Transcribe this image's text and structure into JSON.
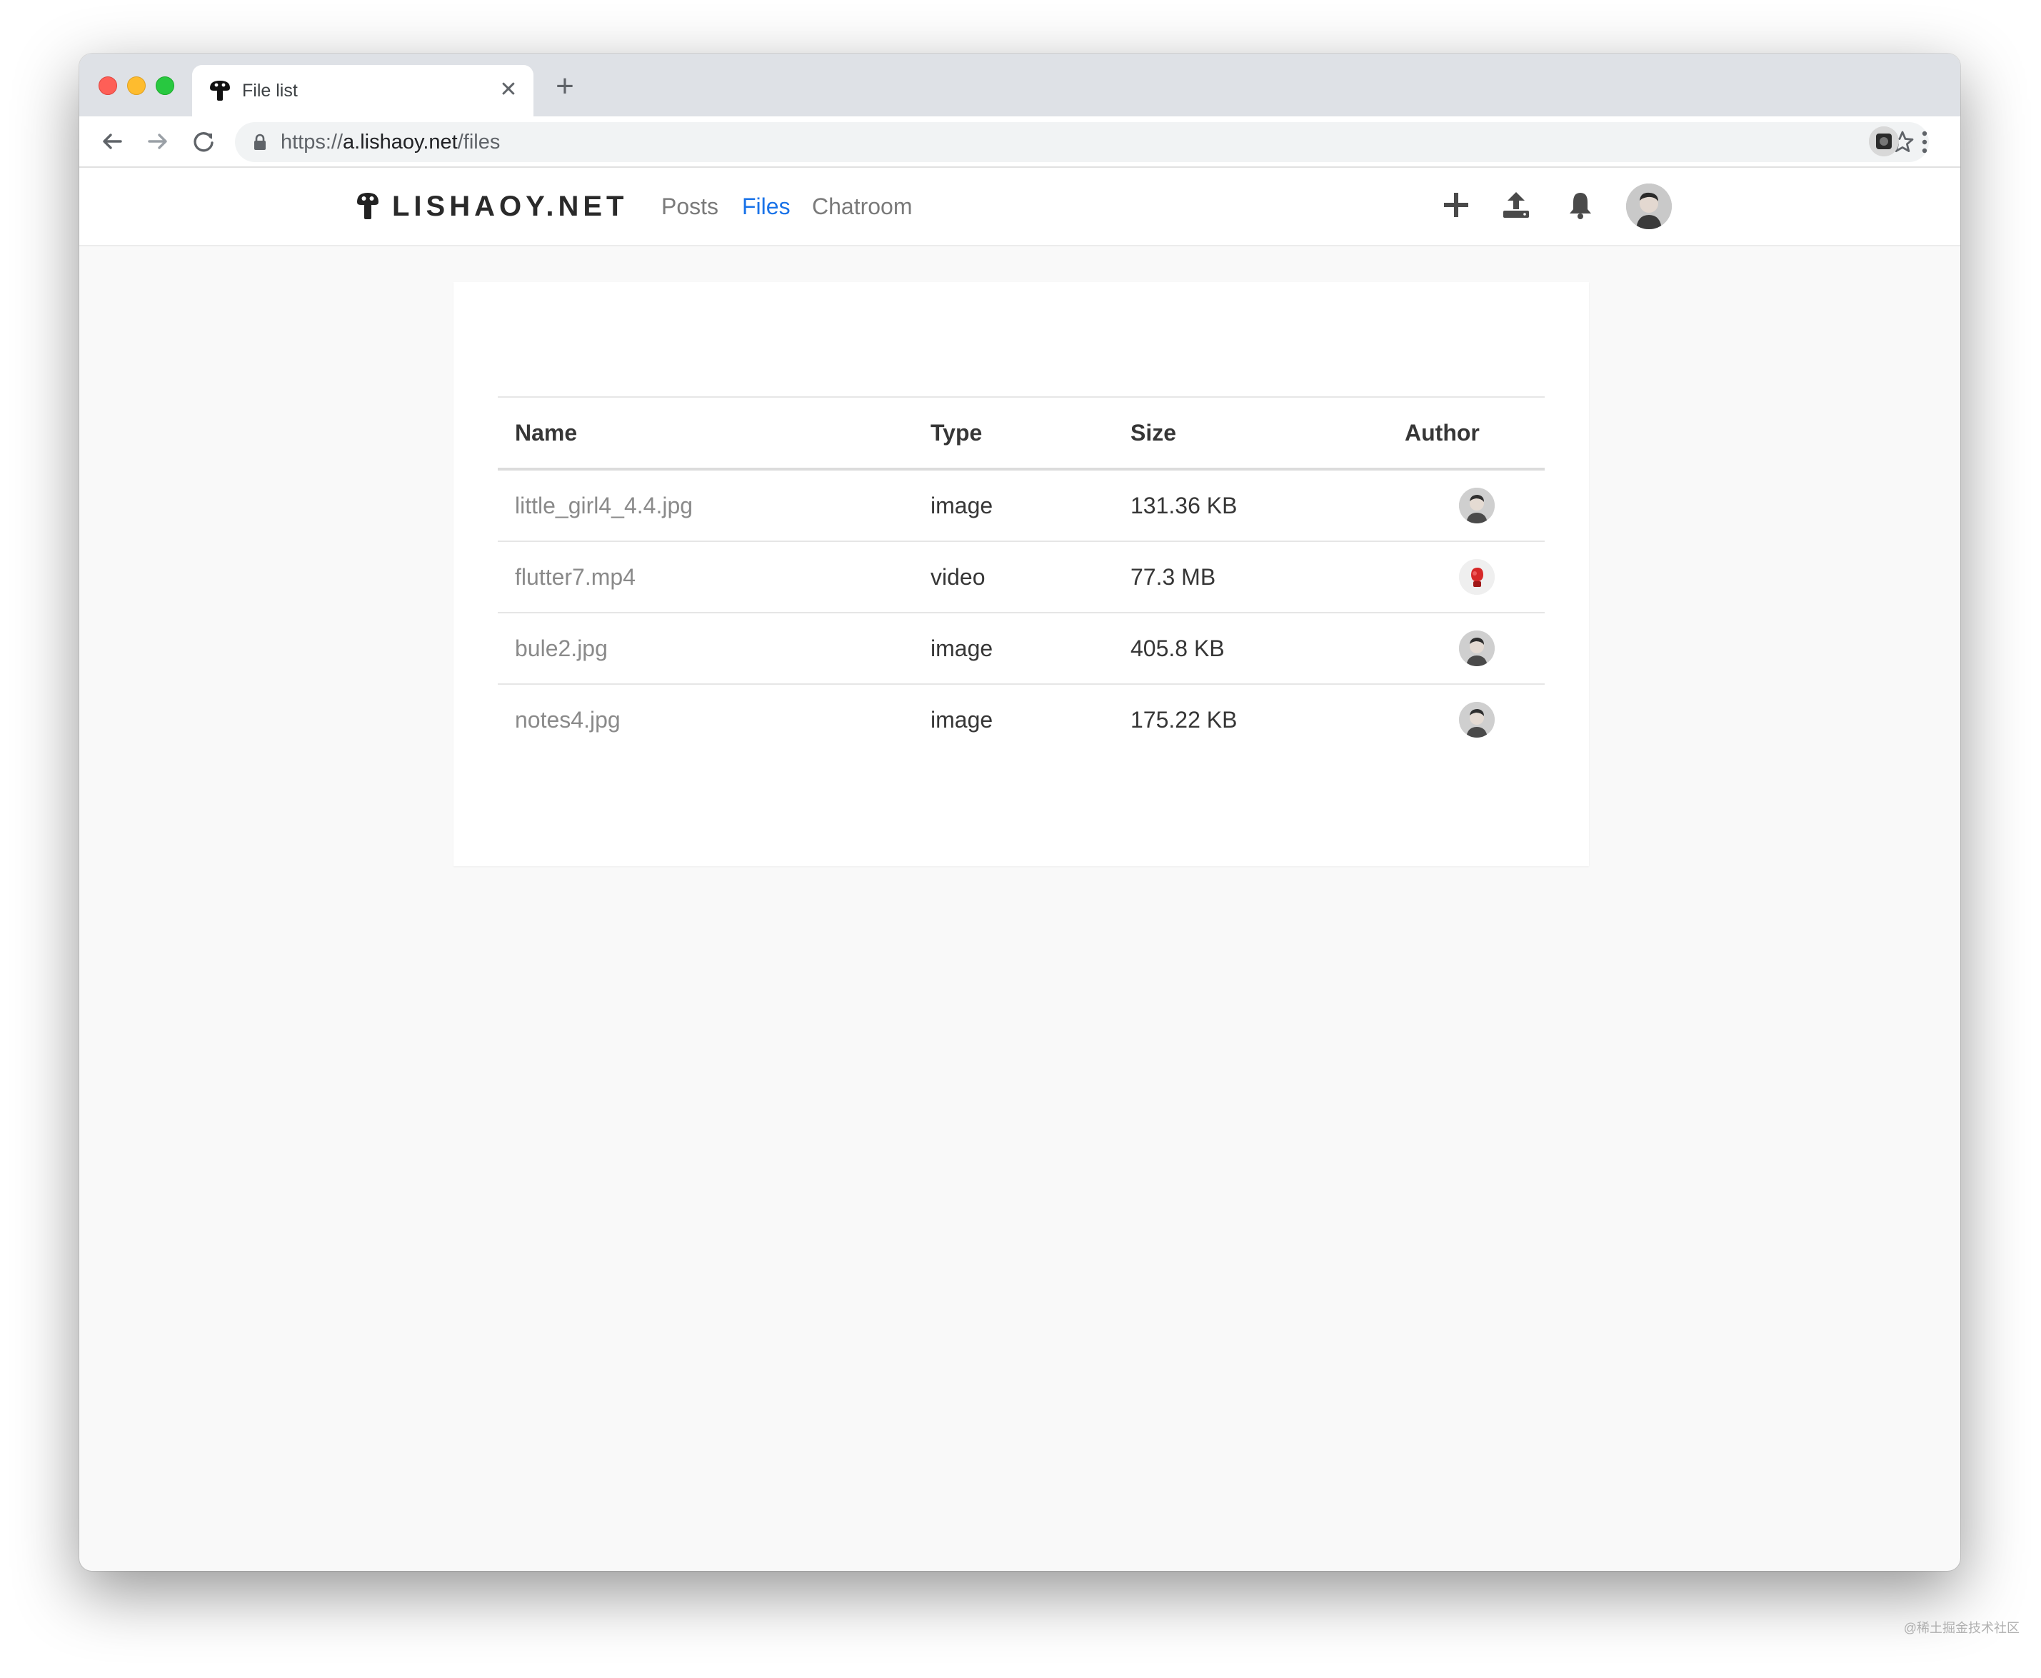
{
  "browser": {
    "tab_title": "File list",
    "url_scheme": "https://",
    "url_host": "a.lishaoy.net",
    "url_path": "/files"
  },
  "site": {
    "logo_text": "LISHAOY.NET",
    "nav": [
      {
        "label": "Posts",
        "active": false
      },
      {
        "label": "Files",
        "active": true
      },
      {
        "label": "Chatroom",
        "active": false
      }
    ],
    "header_icons": [
      "plus-icon",
      "upload-icon",
      "bell-icon",
      "user-avatar"
    ],
    "active_color": "#1a73e8"
  },
  "table": {
    "columns": [
      "Name",
      "Type",
      "Size",
      "Author"
    ],
    "rows": [
      {
        "name": "little_girl4_4.4.jpg",
        "type": "image",
        "size": "131.36 KB",
        "author_avatar": "man-avatar"
      },
      {
        "name": "flutter7.mp4",
        "type": "video",
        "size": "77.3 MB",
        "author_avatar": "boxing-glove-avatar"
      },
      {
        "name": "bule2.jpg",
        "type": "image",
        "size": "405.8 KB",
        "author_avatar": "man-avatar"
      },
      {
        "name": "notes4.jpg",
        "type": "image",
        "size": "175.22 KB",
        "author_avatar": "man-avatar"
      }
    ]
  },
  "watermark": "@稀土掘金技术社区"
}
